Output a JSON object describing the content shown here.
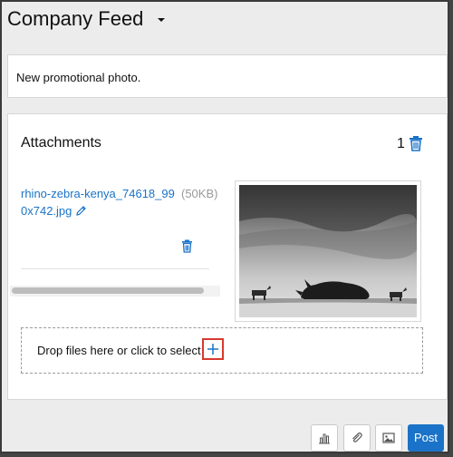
{
  "header": {
    "title": "Company Feed",
    "dropdown_icon": "caret-down-icon"
  },
  "post": {
    "text": "New promotional photo."
  },
  "attachments": {
    "heading": "Attachments",
    "count": "1",
    "delete_all_icon": "trash-icon",
    "files": [
      {
        "name": "rhino-zebra-kenya_74618_990x742.jpg",
        "size": "(50KB)",
        "edit_icon": "pencil-icon",
        "delete_icon": "trash-icon"
      }
    ],
    "dropzone": {
      "text": "Drop files here or click to select",
      "add_icon": "plus-icon"
    }
  },
  "toolbar": {
    "poll_icon": "bar-chart-icon",
    "link_icon": "paperclip-icon",
    "image_icon": "image-icon",
    "post_label": "Post"
  },
  "colors": {
    "accent": "#1a73c8",
    "highlight": "#d63a2e"
  }
}
